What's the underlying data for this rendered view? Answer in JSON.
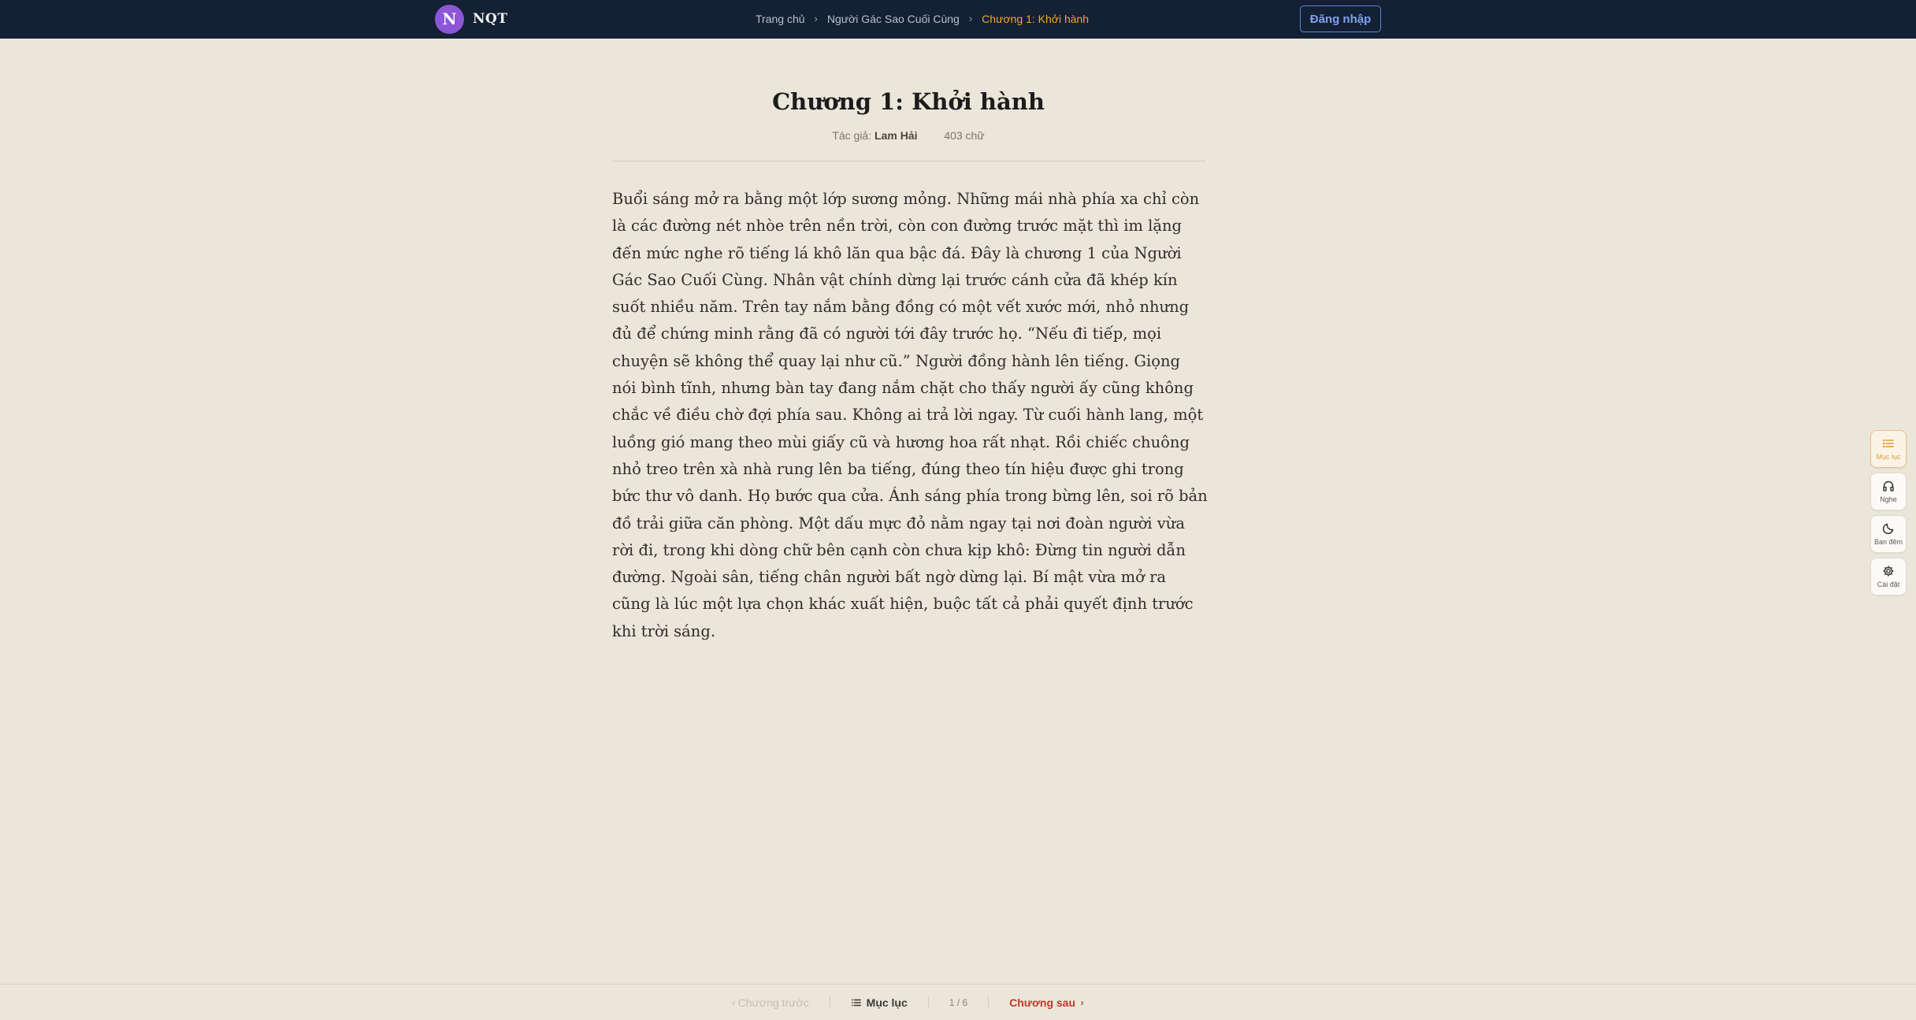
{
  "header": {
    "logo_letter": "N",
    "brand": "NQT",
    "breadcrumb": [
      "Trang chủ",
      "Người Gác Sao Cuối Cùng",
      "Chương 1: Khởi hành"
    ],
    "login_label": "Đăng nhập"
  },
  "chapter": {
    "title": "Chương 1: Khởi hành",
    "author_label": "Tác giả:",
    "author": "Lam Hải",
    "word_count": "403 chữ",
    "body": "Buổi sáng mở ra bằng một lớp sương mỏng. Những mái nhà phía xa chỉ còn là các đường nét nhòe trên nền trời, còn con đường trước mặt thì im lặng đến mức nghe rõ tiếng lá khô lăn qua bậc đá. Đây là chương 1 của Người Gác Sao Cuối Cùng. Nhân vật chính dừng lại trước cánh cửa đã khép kín suốt nhiều năm. Trên tay nắm bằng đồng có một vết xước mới, nhỏ nhưng đủ để chứng minh rằng đã có người tới đây trước họ. “Nếu đi tiếp, mọi chuyện sẽ không thể quay lại như cũ.” Người đồng hành lên tiếng. Giọng nói bình tĩnh, nhưng bàn tay đang nắm chặt cho thấy người ấy cũng không chắc về điều chờ đợi phía sau. Không ai trả lời ngay. Từ cuối hành lang, một luồng gió mang theo mùi giấy cũ và hương hoa rất nhạt. Rồi chiếc chuông nhỏ treo trên xà nhà rung lên ba tiếng, đúng theo tín hiệu được ghi trong bức thư vô danh. Họ bước qua cửa. Ánh sáng phía trong bừng lên, soi rõ bản đồ trải giữa căn phòng. Một dấu mực đỏ nằm ngay tại nơi đoàn người vừa rời đi, trong khi dòng chữ bên cạnh còn chưa kịp khô: Đừng tin người dẫn đường. Ngoài sân, tiếng chân người bất ngờ dừng lại. Bí mật vừa mở ra cũng là lúc một lựa chọn khác xuất hiện, buộc tất cả phải quyết định trước khi trời sáng."
  },
  "side_tools": [
    {
      "label": "Mục lục",
      "icon": "list-icon",
      "active": true
    },
    {
      "label": "Nghe",
      "icon": "headphones-icon",
      "active": false
    },
    {
      "label": "Ban đêm",
      "icon": "moon-icon",
      "active": false
    },
    {
      "label": "Cài đặt",
      "icon": "gear-icon",
      "active": false
    }
  ],
  "bottom_nav": {
    "prev_label": "Chương trước",
    "toc_label": "Mục lục",
    "page": "1 / 6",
    "next_label": "Chương sau"
  },
  "colors": {
    "header_bg": "#142034",
    "page_bg": "#ebe6da",
    "accent_orange": "#f2a531",
    "next_red": "#c0392b",
    "logo_purple": "#8b57d6"
  }
}
